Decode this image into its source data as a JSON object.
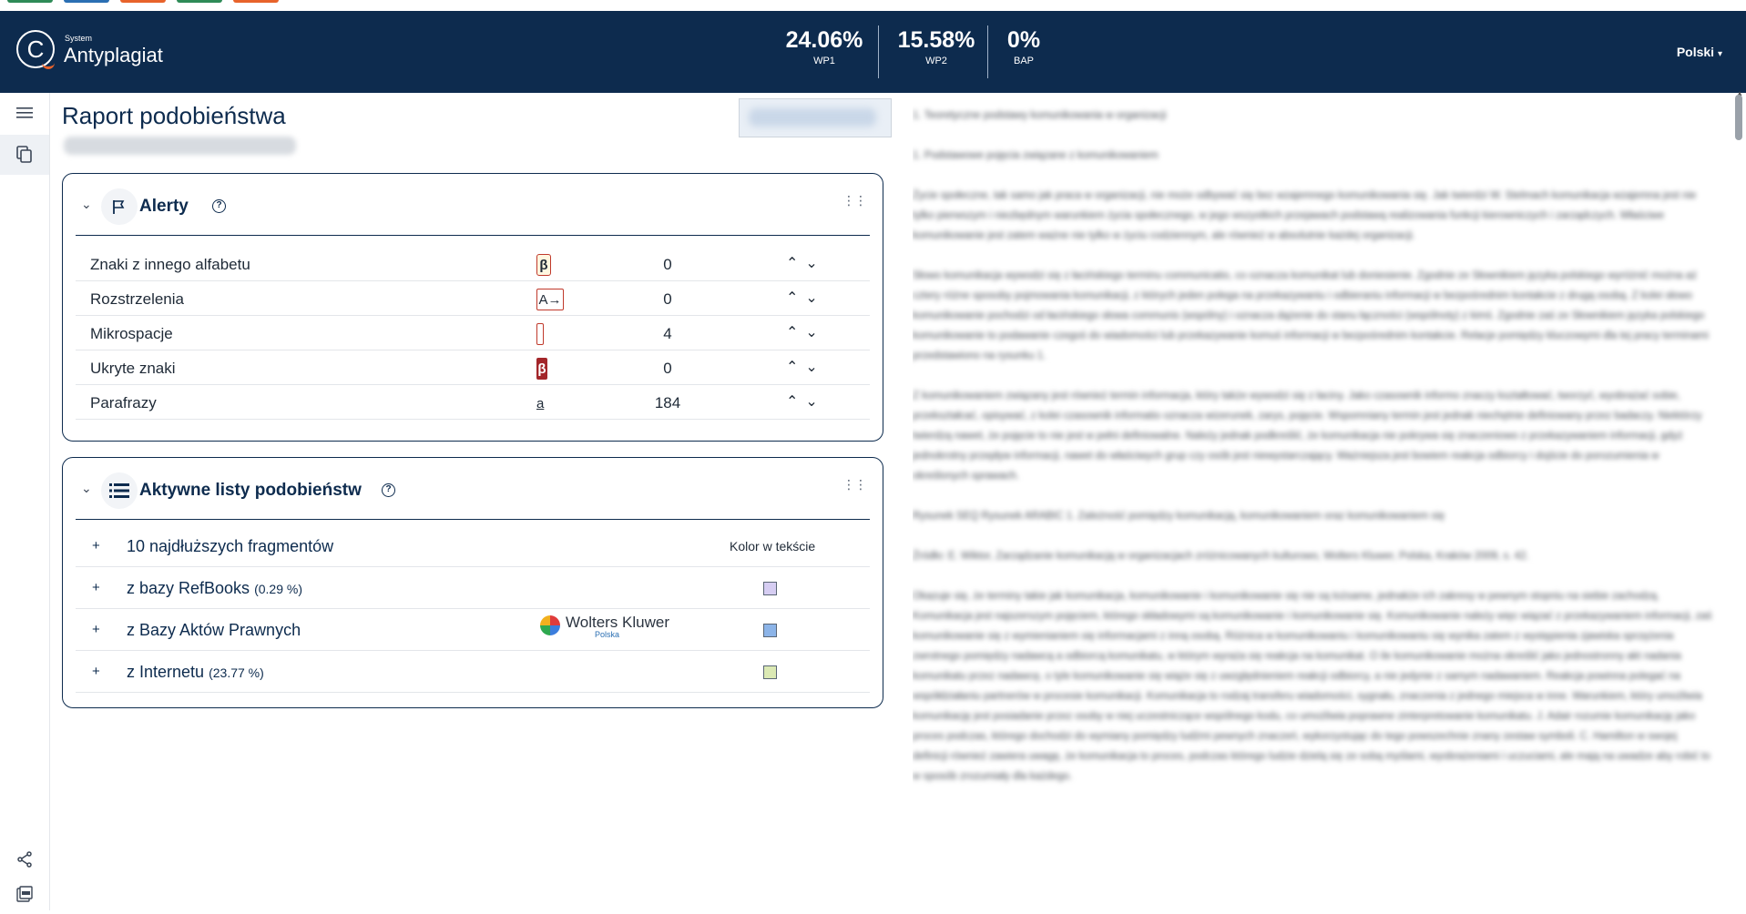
{
  "header": {
    "logo_small": "System",
    "logo_big": "Antyplagiat",
    "stats": [
      {
        "value": "24.06%",
        "label": "WP1"
      },
      {
        "value": "15.58%",
        "label": "WP2"
      },
      {
        "value": "0%",
        "label": "BAP"
      }
    ],
    "language": "Polski"
  },
  "colors": {
    "navy": "#0d2b4e",
    "accent_orange": "#e8632b",
    "alert_red": "#c0392b",
    "highlight": "#e6efa8"
  },
  "report": {
    "title": "Raport podobieństwa"
  },
  "alerts": {
    "title": "Alerty",
    "help": "?",
    "rows": [
      {
        "name": "Znaki z innego alfabetu",
        "glyph": "β",
        "count": "0"
      },
      {
        "name": "Rozstrzelenia",
        "glyph": "A→",
        "count": "0"
      },
      {
        "name": "Mikrospacje",
        "glyph": "",
        "count": "4"
      },
      {
        "name": "Ukryte znaki",
        "glyph": "β",
        "count": "0"
      },
      {
        "name": "Parafrazy",
        "glyph": "a",
        "count": "184"
      }
    ]
  },
  "lists": {
    "title": "Aktywne listy podobieństw",
    "help": "?",
    "color_header": "Kolor w tekście",
    "rows": [
      {
        "name": "10 najdłuższych fragmentów",
        "pct": ""
      },
      {
        "name": "z bazy RefBooks",
        "pct": "(0.29 %)",
        "swatch": "#d6cdf2"
      },
      {
        "name": "z Bazy Aktów Prawnych",
        "pct": "",
        "swatch": "#8cb4e8",
        "logo_name": "Wolters Kluwer",
        "logo_sub": "Polska"
      },
      {
        "name": "z Internetu",
        "pct": "(23.77 %)",
        "swatch": "#dbe9b4"
      }
    ]
  },
  "document": {
    "paragraphs": [
      "1. Teoretyczne podstawy komunikowania w organizacji",
      "1. Podstawowe pojęcia związane z komunikowaniem",
      "Życie społeczne, tak samo jak praca w organizacji, nie może odbywać się bez wzajemnego komunikowania się. Jak twierdzi W. Stelmach komunikacja wzajemna jest nie tylko pierwszym i niezbędnym warunkiem życia społecznego, w jego wszystkich przejawach podstawą realizowania funkcji kierowniczych i zarządczych. Właściwe komunikowanie jest zatem ważne nie tylko w życiu codziennym, ale również w absolutnie każdej organizacji.",
      "Słowo komunikacja wywodzi się z łacińskiego terminu communicatio, co oznacza komunikat lub doniesienie. Zgodnie ze Słownikiem języka polskiego wyróżnić można aż cztery różne sposoby pojmowania komunikacji, z których jeden polega na przekazywaniu i odbieraniu informacji w bezpośrednim kontakcie z drugą osobą. Z kolei słowo komunikowanie pochodzi od łacińskiego słowa communis (wspólny) i oznacza dążenie do stanu łączności (wspólnoty) z kimś. Zgodnie zaś ze Słownikiem języka polskiego komunikowanie to podawanie czegoś do wiadomości lub przekazywanie komuś informacji w bezpośrednim kontakcie. Relacje pomiędzy kluczowymi dla tej pracy terminami przedstawiono na rysunku 1.",
      "Z komunikowaniem związany jest również termin informacja, który także wywodzi się z łaciny. Jako czasownik informo znaczy kształtować, tworzyć, wyobrażać sobie, przekształcać, opisywać, z kolei czasownik informatio oznacza wizerunek, zarys, pojęcie. Wspomniany termin jest jednak niechętnie definiowany przez badaczy. Niektórzy twierdzą nawet, że pojęcie to nie jest w pełni definiowalne. Należy jednak podkreślić, że komunikacja nie pokrywa się znaczeniowo z przekazywaniem informacji, gdyż jednokrotny przepływ informacji, nawet do właściwych grup czy osób jest niewystarczający. Ważniejsza jest bowiem reakcja odbiorcy i dojście do porozumienia w określonych sprawach.",
      "Rysunek SEQ Rysunek ARABIC 1. Zależność pomiędzy komunikacją, komunikowaniem oraz komunikowaniem się",
      "Źródło: E. Wiktor, Zarządzanie komunikacją w organizacjach zróżnicowanych kulturowo, Wolters Kluwer, Polska, Kraków 2009, s. 42.",
      "Okazuje się, że terminy takie jak komunikacja, komunikowanie i komunikowanie się nie są tożsame, jednakże ich zakresy w pewnym stopniu na siebie zachodzą. Komunikacja jest najszerszym pojęciem, którego składowymi są komunikowanie i komunikowanie się. Komunikowanie należy więc wiązać z przekazywaniem informacji, zaś komunikowanie się z wymienianiem się informacjami z inną osobą. Różnica w komunikowaniu i komunikowaniu się wynika zatem z występienia zjawiska sprzężenia zwrotnego pomiędzy nadawcą a odbiorcą komunikatu, w którym wyraża się reakcja na komunikat. O ile komunikowanie można określić jako jednostronny akt nadania komunikatu przez nadawcę, o tyle komunikowanie się wiąże się z uwzględnieniem reakcji odbiorcy, a nie jedynie z samym nadawaniem. Reakcja powinna polegać na współdziałaniu partnerów w procesie komunikacji. Komunikacja to rodzaj transferu wiadomości, sygnału, znaczenia z jednego miejsca w inne. Warunkiem, który umożliwia komunikację jest posiadanie przez osoby w niej uczestniczące wspólnego kodu, co umożliwia poprawne zinterpretowanie komunikatu. J. Adair rozumie komunikację jako proces podczas, którego dochodzi do wymiany pomiędzy ludźmi pewnych znaczeń, wykorzystując do tego powszechnie znany zestaw symboli. C. Hamilton w swojej definicji również zawiera uwagę, że komunikacja to proces, podczas którego ludzie dzielą się ze sobą myślami, wyobrażeniami i uczuciami, ale mają na uwadze aby robić to w sposób zrozumiały dla każdego."
    ]
  }
}
